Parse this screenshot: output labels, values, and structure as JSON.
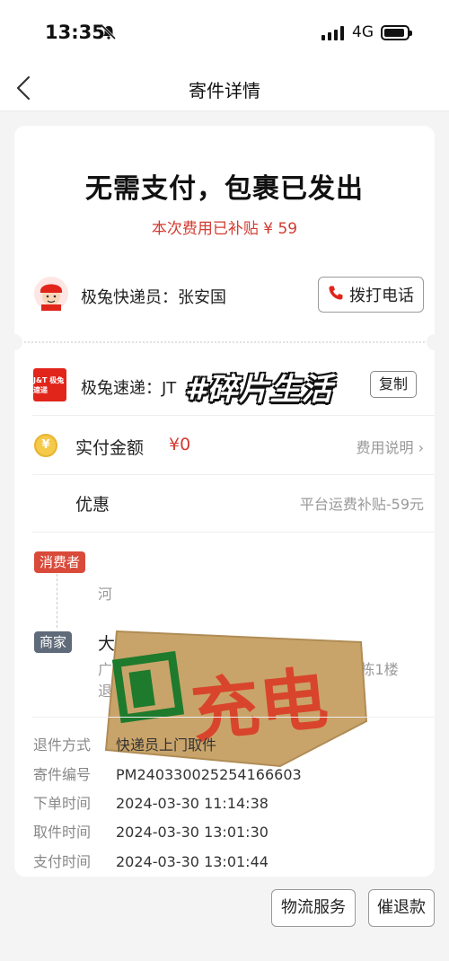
{
  "status": {
    "time": "13:35",
    "network": "4G",
    "battery_level": 0.9
  },
  "nav": {
    "title": "寄件详情"
  },
  "summary": {
    "headline": "无需支付，包裹已发出",
    "subsidy": "本次费用已补贴 ¥ 59"
  },
  "courier": {
    "label": "极兔快递员：张安国",
    "call_label": "拨打电话"
  },
  "carrier": {
    "logo_text": "J&T 极兔速递",
    "label": "极兔速递：JT",
    "copy_label": "复制",
    "watermark": "#碎片生活"
  },
  "payment": {
    "paid_label": "实付金额",
    "paid_value": "¥0",
    "fee_link": "费用说明 ›",
    "discount_label": "优惠",
    "discount_value": "平台运费补贴-59元"
  },
  "addresses": {
    "consumer_tag": "消费者",
    "consumer_partial": "河",
    "merchant_tag": "商家",
    "merchant_name": "大鸡腿 188897026",
    "merchant_address": "广东省 中山市 西区街道 街道政安路8号A栋1楼退货区。 退回工厂"
  },
  "sticker": {
    "text": "充电"
  },
  "details": [
    {
      "key": "退件方式",
      "value": "快递员上门取件"
    },
    {
      "key": "寄件编号",
      "value": "PM240330025254166603"
    },
    {
      "key": "下单时间",
      "value": "2024-03-30 11:14:38"
    },
    {
      "key": "取件时间",
      "value": "2024-03-30 13:01:30"
    },
    {
      "key": "支付时间",
      "value": "2024-03-30 13:01:44"
    }
  ],
  "actions": {
    "logistics": "物流服务",
    "urge": "催退款"
  },
  "colors": {
    "accent_red": "#d23b32",
    "merchant_tag": "#5f6b7a",
    "consumer_tag": "#d94a3a"
  }
}
